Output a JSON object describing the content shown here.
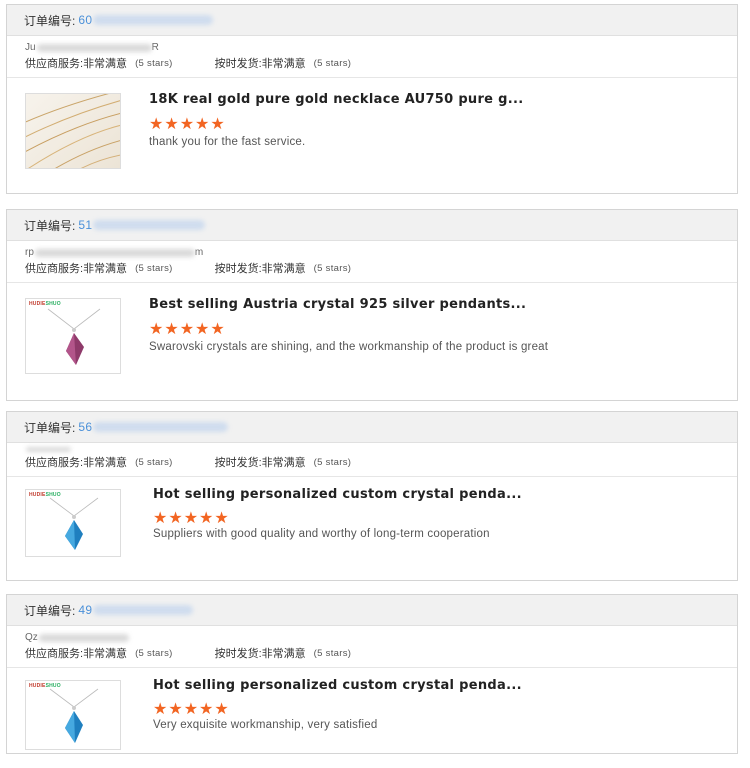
{
  "labels": {
    "order_no": "订单编号:",
    "supplier_service": "供应商服务:",
    "on_time_delivery": "按时发货:",
    "rating_text": "非常满意",
    "rating_stars_text": "(5 stars)",
    "brand_a": "HUDIE",
    "brand_b": "SHUO"
  },
  "orders": [
    {
      "order_prefix": "60",
      "buyer_prefix": "Ju",
      "buyer_suffix": "R",
      "product_title": "18K real gold pure gold necklace AU750 pure g...",
      "stars": "★★★★★",
      "rating": 5,
      "review": "thank you for the fast service."
    },
    {
      "order_prefix": "51",
      "buyer_prefix": "rp",
      "buyer_suffix": "m",
      "product_title": "Best selling Austria crystal 925 silver pendants...",
      "stars": "★★★★★",
      "rating": 5,
      "review": "Swarovski crystals are shining, and the workmanship of the product is great"
    },
    {
      "order_prefix": "56",
      "buyer_prefix": "",
      "buyer_suffix": "",
      "product_title": "Hot selling personalized custom crystal penda...",
      "stars": "★★★★★",
      "rating": 5,
      "review": "Suppliers with good quality and worthy of long-term cooperation"
    },
    {
      "order_prefix": "49",
      "buyer_prefix": "Qz",
      "buyer_suffix": "",
      "product_title": "Hot selling personalized custom crystal penda...",
      "stars": "★★★★★",
      "rating": 5,
      "review": "Very exquisite workmanship, very satisfied"
    }
  ],
  "colors": {
    "star": "#f26522",
    "order_link": "#4a90d9",
    "header_bg": "#f1f1f1"
  }
}
